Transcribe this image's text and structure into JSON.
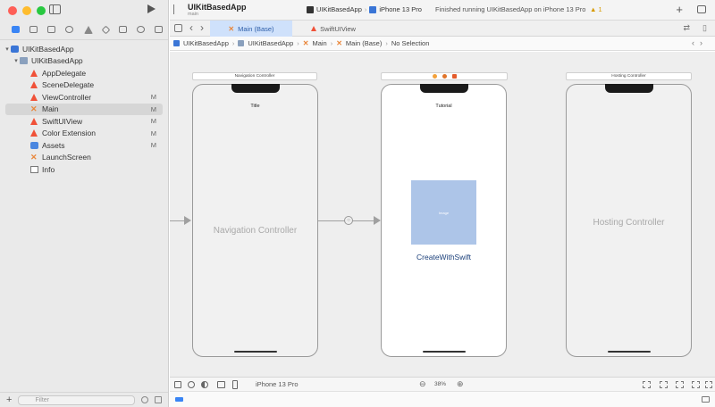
{
  "toolbar": {
    "project_title": "UIKitBasedApp",
    "branch": "main",
    "scheme": "UIKitBasedApp",
    "destination": "iPhone 13 Pro",
    "status": "Finished running UIKitBasedApp on iPhone 13 Pro",
    "warning": "▲ 1"
  },
  "tabs": [
    {
      "label": "Main (Base)",
      "icon": "storyboard-icon",
      "active": true
    },
    {
      "label": "SwiftUIView",
      "icon": "swift-file-icon",
      "active": false
    }
  ],
  "jumpbar": {
    "items": [
      "UIKitBasedApp",
      "UIKitBasedApp",
      "Main",
      "Main (Base)",
      "No Selection"
    ]
  },
  "navigator": {
    "items": [
      {
        "label": "UIKitBasedApp",
        "icon": "app-project-icon",
        "badge": ""
      },
      {
        "label": "UIKitBasedApp",
        "icon": "folder-icon",
        "badge": ""
      },
      {
        "label": "AppDelegate",
        "icon": "swift-file-icon",
        "badge": ""
      },
      {
        "label": "SceneDelegate",
        "icon": "swift-file-icon",
        "badge": ""
      },
      {
        "label": "ViewController",
        "icon": "swift-file-icon",
        "badge": "M"
      },
      {
        "label": "Main",
        "icon": "storyboard-icon",
        "badge": "M"
      },
      {
        "label": "SwiftUIView",
        "icon": "swift-file-icon",
        "badge": "M"
      },
      {
        "label": "Color Extension",
        "icon": "swift-file-icon",
        "badge": "M"
      },
      {
        "label": "Assets",
        "icon": "asset-catalog-icon",
        "badge": "M"
      },
      {
        "label": "LaunchScreen",
        "icon": "storyboard-icon",
        "badge": ""
      },
      {
        "label": "Info",
        "icon": "plist-icon",
        "badge": ""
      }
    ],
    "filter_placeholder": "Filter"
  },
  "canvas": {
    "scene1": {
      "header": "Navigation Controller",
      "nav_title": "Title",
      "label": "Navigation Controller"
    },
    "scene2": {
      "nav_title": "Tutorial",
      "image_label": "Image",
      "caption": "CreateWithSwift"
    },
    "scene3": {
      "header": "Hosting Controller",
      "label": "Hosting Controller"
    }
  },
  "bottombar": {
    "device": "iPhone 13 Pro",
    "zoom": "38%"
  },
  "colors": {
    "accent": "#3a85f5",
    "active_tab": "#cfe1fb",
    "image_placeholder": "#adc5e8",
    "swift_orange": "#f05138"
  }
}
